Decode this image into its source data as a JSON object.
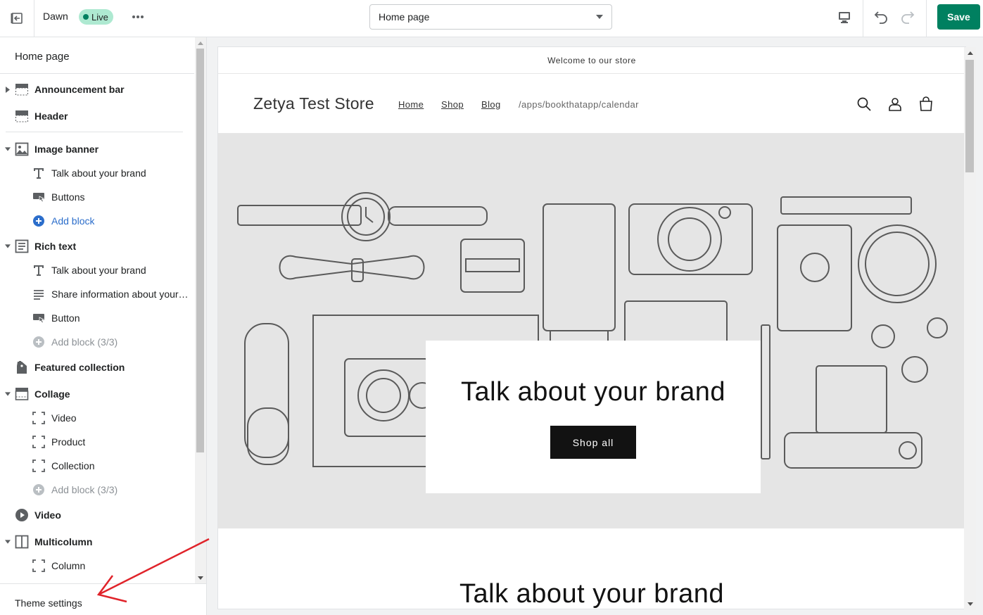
{
  "topbar": {
    "theme_name": "Dawn",
    "status_badge": "Live",
    "page_selector": "Home page",
    "save_label": "Save"
  },
  "sidebar": {
    "title": "Home page",
    "sections": [
      {
        "label": "Announcement bar",
        "icon": "announcement-icon"
      },
      {
        "label": "Header",
        "icon": "header-icon"
      },
      {
        "label": "Image banner",
        "icon": "image-icon",
        "blocks": [
          {
            "label": "Talk about your brand",
            "icon": "text-icon"
          },
          {
            "label": "Buttons",
            "icon": "button-icon"
          },
          {
            "label": "Add block",
            "icon": "add-icon"
          }
        ]
      },
      {
        "label": "Rich text",
        "icon": "rich-text-icon",
        "blocks": [
          {
            "label": "Talk about your brand",
            "icon": "text-icon"
          },
          {
            "label": "Share information about your…",
            "icon": "paragraph-icon"
          },
          {
            "label": "Button",
            "icon": "button-icon"
          },
          {
            "label": "Add block (3/3)",
            "icon": "add-icon"
          }
        ]
      },
      {
        "label": "Featured collection",
        "icon": "tag-icon"
      },
      {
        "label": "Collage",
        "icon": "collage-icon",
        "blocks": [
          {
            "label": "Video",
            "icon": "placeholder-block-icon"
          },
          {
            "label": "Product",
            "icon": "placeholder-block-icon"
          },
          {
            "label": "Collection",
            "icon": "placeholder-block-icon"
          },
          {
            "label": "Add block (3/3)",
            "icon": "add-icon"
          }
        ]
      },
      {
        "label": "Video",
        "icon": "play-icon"
      },
      {
        "label": "Multicolumn",
        "icon": "columns-icon",
        "blocks": [
          {
            "label": "Column",
            "icon": "placeholder-block-icon"
          }
        ]
      }
    ],
    "theme_settings": "Theme settings"
  },
  "preview": {
    "announcement": "Welcome to our store",
    "store_name": "Zetya Test Store",
    "nav": [
      "Home",
      "Shop",
      "Blog",
      "/apps/bookthatapp/calendar"
    ],
    "banner_heading": "Talk about your brand",
    "banner_button": "Shop all",
    "rich_text_heading": "Talk about your brand"
  },
  "colors": {
    "primary": "#008060",
    "live_badge": "#aee9d1",
    "link_blue": "#2c6ecb",
    "annotation_arrow": "#e0232a"
  }
}
